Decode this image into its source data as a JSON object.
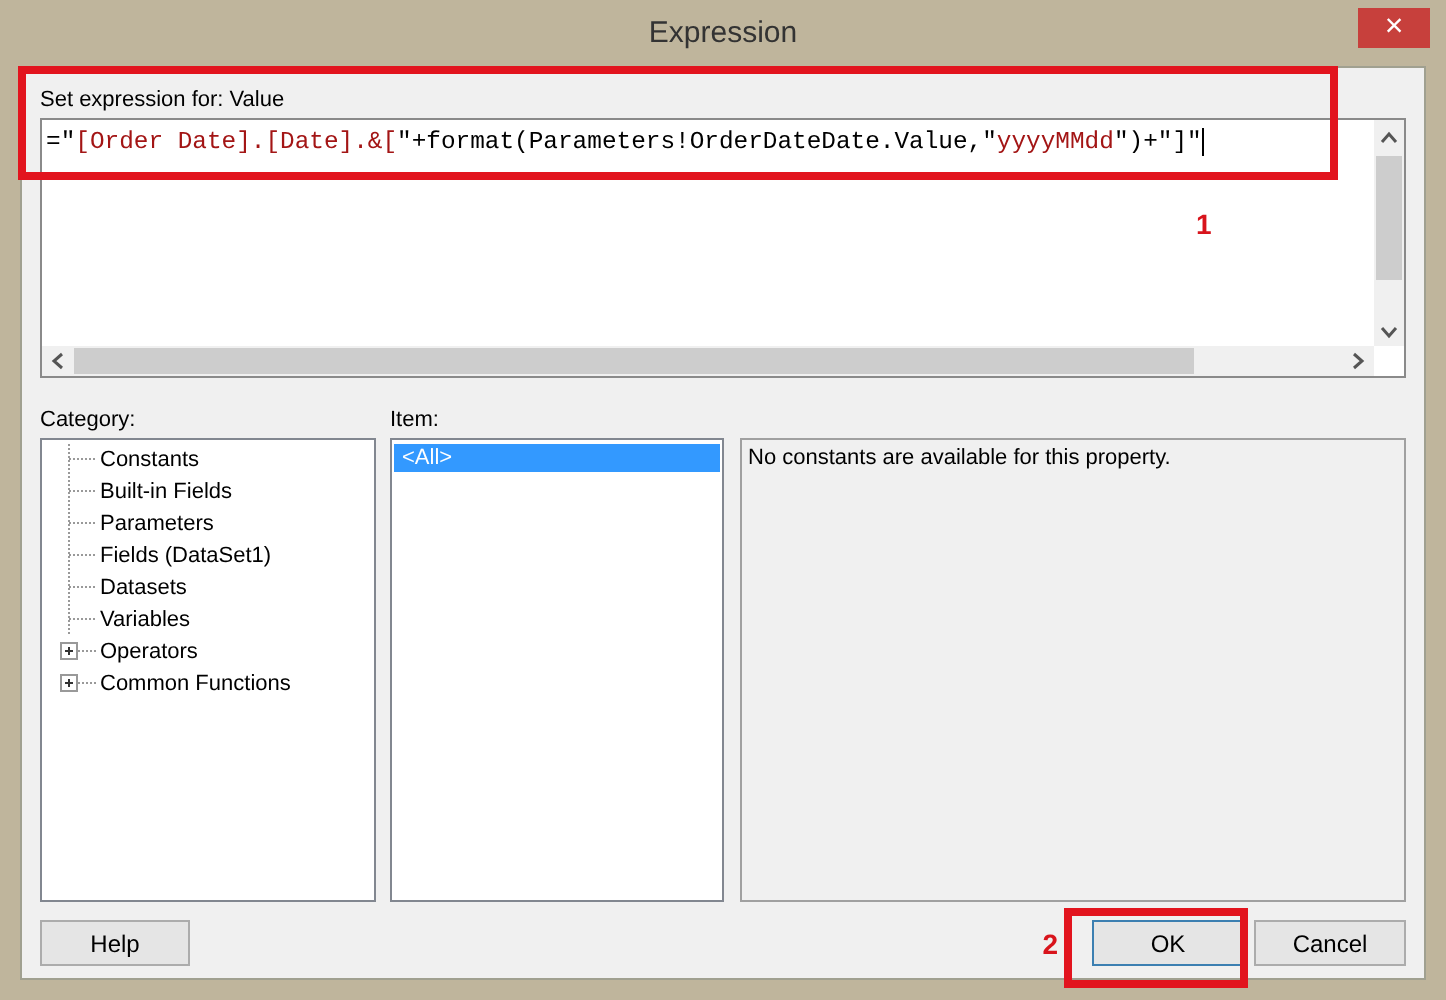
{
  "window": {
    "title": "Expression",
    "close_icon": "×"
  },
  "expression": {
    "label": "Set expression for: Value",
    "segments": [
      {
        "kind": "code",
        "text": "=\""
      },
      {
        "kind": "string",
        "text": "[Order Date].[Date].&["
      },
      {
        "kind": "code",
        "text": "\"+format(Parameters!OrderDateDate.Value,\""
      },
      {
        "kind": "string",
        "text": "yyyyMMdd"
      },
      {
        "kind": "code",
        "text": "\")+\"]\""
      }
    ]
  },
  "category": {
    "label": "Category:",
    "items": [
      {
        "label": "Constants",
        "expandable": false
      },
      {
        "label": "Built-in Fields",
        "expandable": false
      },
      {
        "label": "Parameters",
        "expandable": false
      },
      {
        "label": "Fields (DataSet1)",
        "expandable": false
      },
      {
        "label": "Datasets",
        "expandable": false
      },
      {
        "label": "Variables",
        "expandable": false
      },
      {
        "label": "Operators",
        "expandable": true
      },
      {
        "label": "Common Functions",
        "expandable": true
      }
    ]
  },
  "item": {
    "label": "Item:",
    "items": [
      {
        "label": "<All>",
        "selected": true
      }
    ]
  },
  "description": "No constants are available for this property.",
  "annotations": [
    "1",
    "2"
  ],
  "buttons": [
    {
      "label": "Help",
      "kind": "help"
    },
    {
      "label": "OK",
      "kind": "ok"
    },
    {
      "label": "Cancel",
      "kind": "cancel"
    }
  ]
}
